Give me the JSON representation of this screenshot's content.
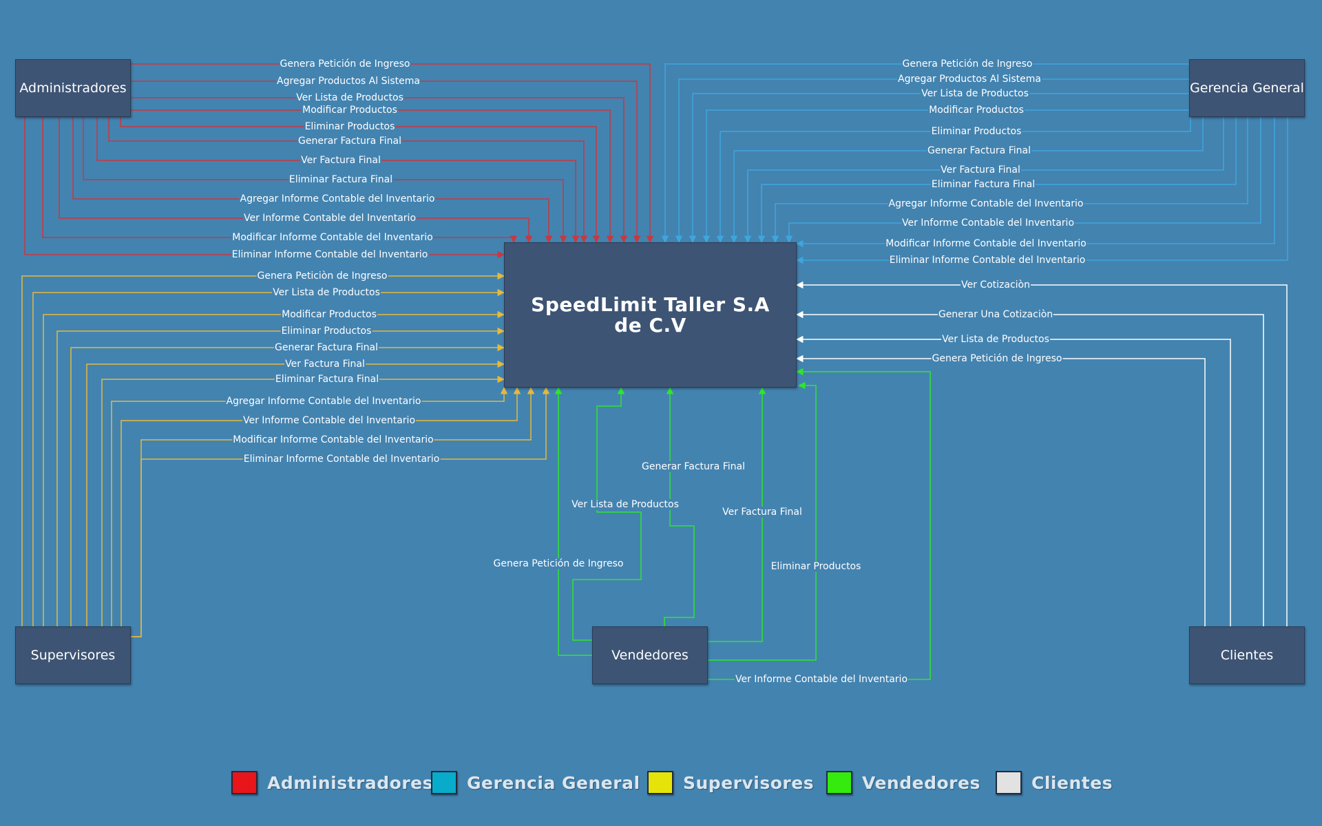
{
  "center": {
    "title": "SpeedLimit Taller S.A de C.V"
  },
  "entities": {
    "admin": "Administradores",
    "gerencia": "Gerencia General",
    "supervisores": "Supervisores",
    "vendedores": "Vendedores",
    "clientes": "Clientes"
  },
  "colors": {
    "admin": "#c8383f",
    "gerencia": "#3fa6dd",
    "supervisores": "#e7b93c",
    "vendedores": "#2fe62b",
    "clientes": "#ffffff"
  },
  "flows": {
    "admin": [
      "Genera Petición de Ingreso",
      "Agregar Productos Al Sistema",
      "Ver Lista de Productos",
      "Modificar Productos",
      "Eliminar Productos",
      "Generar Factura Final",
      "Ver Factura Final",
      "Eliminar Factura Final",
      "Agregar Informe Contable del Inventario",
      "Ver Informe Contable del Inventario",
      "Modificar Informe Contable del Inventario",
      "Eliminar Informe Contable del Inventario"
    ],
    "gerencia": [
      "Genera Petición de Ingreso",
      "Agregar Productos Al Sistema",
      "Ver Lista de Productos",
      "Modificar Productos",
      "Eliminar Productos",
      "Generar Factura Final",
      "Ver Factura Final",
      "Eliminar Factura Final",
      "Agregar Informe Contable del Inventario",
      "Ver Informe Contable del Inventario",
      "Modificar Informe Contable del Inventario",
      "Eliminar Informe Contable del Inventario"
    ],
    "supervisores": [
      "Genera Peticiòn de Ingreso",
      "Ver Lista de Productos",
      "Modificar Productos",
      "Eliminar Productos",
      "Generar Factura Final",
      "Ver Factura Final",
      "Eliminar Factura Final",
      "Agregar Informe Contable del Inventario",
      "Ver Informe Contable del Inventario",
      "Modificar Informe Contable del Inventario",
      "Eliminar Informe Contable del Inventario"
    ],
    "clientes": [
      "Ver Cotizaciòn",
      "Generar Una Cotizaciòn",
      "Ver Lista de Productos",
      "Genera Petición de Ingreso"
    ],
    "vendedores": [
      "Genera Petición de Ingreso",
      "Ver Lista de Productos",
      "Generar Factura Final",
      "Ver Factura Final",
      "Eliminar Productos",
      "Ver Informe Contable del Inventario"
    ]
  },
  "legend": [
    {
      "label": "Administradores",
      "color": "#e8151b"
    },
    {
      "label": "Gerencia General",
      "color": "#08abc9"
    },
    {
      "label": "Supervisores",
      "color": "#e6e30a"
    },
    {
      "label": "Vendedores",
      "color": "#35ea0d"
    },
    {
      "label": "Clientes",
      "color": "#e2e2e2"
    }
  ]
}
